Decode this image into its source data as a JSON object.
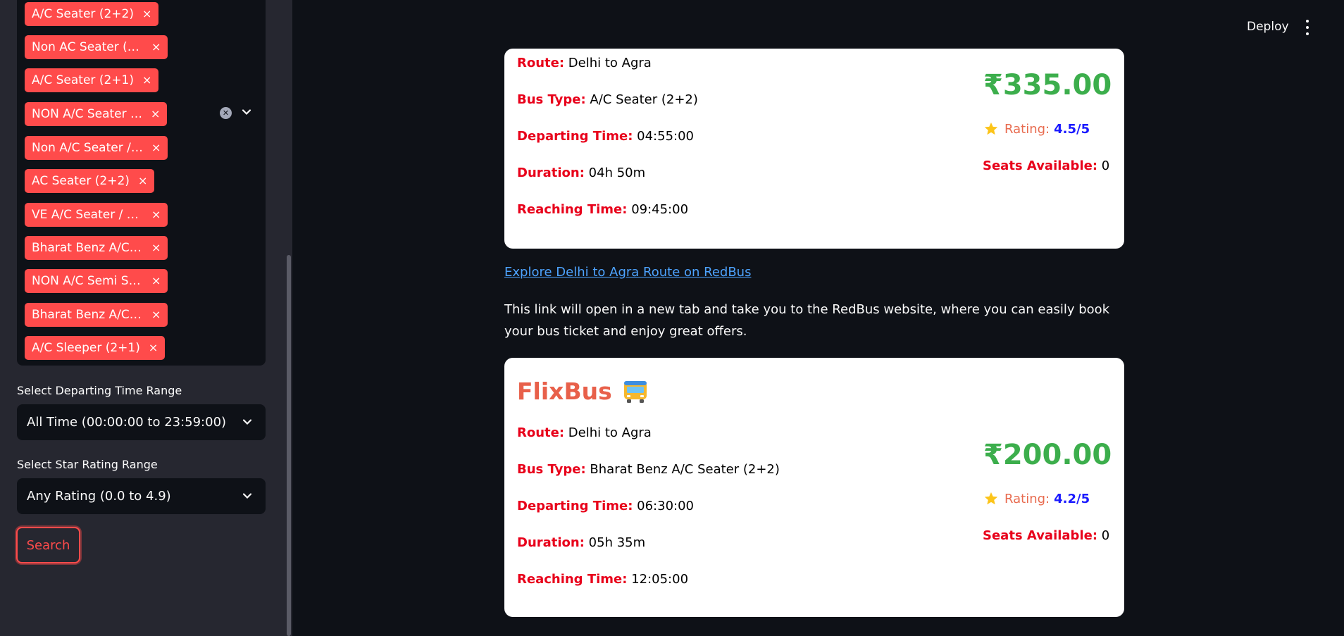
{
  "sidebar": {
    "bus_type_chips": [
      "A/C Seater (2+2)",
      "Non AC Seater (2…",
      "A/C Seater (2+1)",
      "NON A/C Seater …",
      "Non A/C Seater / …",
      "AC Seater (2+2)",
      "VE A/C Seater / S…",
      "Bharat Benz A/C …",
      "NON A/C Semi Sl…",
      "Bharat Benz A/C …",
      "A/C Sleeper (2+1)"
    ],
    "chip_remove": "×",
    "departing_label": "Select Departing Time Range",
    "departing_value": "All Time (00:00:00 to 23:59:00)",
    "rating_label": "Select Star Rating Range",
    "rating_value": "Any Rating (0.0 to 4.9)",
    "search_label": "Search"
  },
  "header": {
    "deploy_label": "Deploy"
  },
  "labels": {
    "route": "Route:",
    "bus_type": "Bus Type:",
    "departing": "Departing Time:",
    "duration": "Duration:",
    "reaching": "Reaching Time:",
    "rating": "Rating:",
    "seats": "Seats Available:"
  },
  "cards": [
    {
      "route": "Delhi to Agra",
      "bus_type": "A/C Seater (2+2)",
      "departing": "04:55:00",
      "duration": "04h 50m",
      "reaching": "09:45:00",
      "price": "₹335.00",
      "rating": "4.5/5",
      "seats": "0"
    },
    {
      "name": "FlixBus",
      "route": "Delhi to Agra",
      "bus_type": "Bharat Benz A/C Seater (2+2)",
      "departing": "06:30:00",
      "duration": "05h 35m",
      "reaching": "12:05:00",
      "price": "₹200.00",
      "rating": "4.2/5",
      "seats": "0"
    }
  ],
  "link_text": "Explore Delhi to Agra Route on RedBus",
  "info_text": "This link will open in a new tab and take you to the RedBus website, where you can easily book your bus ticket and enjoy great offers."
}
